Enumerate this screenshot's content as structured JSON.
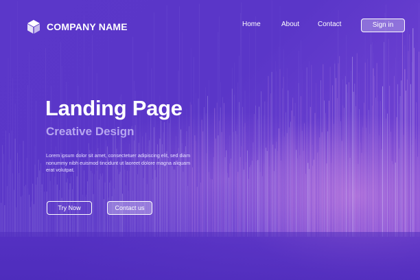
{
  "header": {
    "brand": "COMPANY NAME",
    "logo_icon": "cube-icon",
    "nav": [
      {
        "label": "Home"
      },
      {
        "label": "About"
      },
      {
        "label": "Contact"
      }
    ],
    "signin_label": "Sign in"
  },
  "hero": {
    "title": "Landing Page",
    "subtitle": "Creative Design",
    "body": "Lorem ipsum dolor sit amet, consectetuer adipiscing elit, sed diam nonummy nibh euismod tincidunt ut laoreet dolore magna aliquam erat volutpat.",
    "primary_button": "Try Now",
    "secondary_button": "Contact us"
  },
  "colors": {
    "background": "#5b37c9",
    "accent_glow": "#f4a8e6",
    "subtitle": "#b7a6f0",
    "text": "#ffffff"
  }
}
